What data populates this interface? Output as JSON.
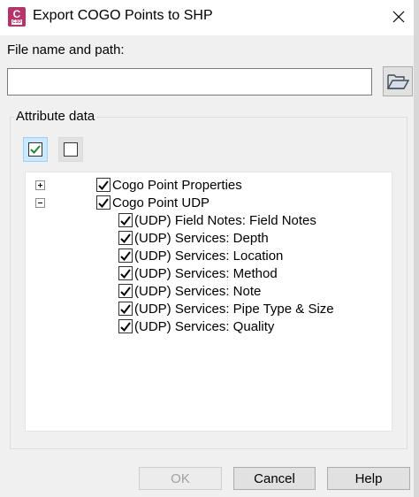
{
  "window": {
    "title": "Export COGO Points to SHP",
    "app_icon_letter": "C",
    "app_icon_sub": "C3D",
    "app_icon_color": "#b8336a"
  },
  "file": {
    "label": "File name and path:",
    "value": "",
    "placeholder": ""
  },
  "attributes": {
    "group_label": "Attribute data",
    "check_all_icon": "check-all-icon",
    "uncheck_all_icon": "uncheck-all-icon"
  },
  "tree": {
    "nodes": [
      {
        "label": "Cogo Point Properties",
        "checked": true,
        "expanded": false,
        "level": 0
      },
      {
        "label": "Cogo Point UDP",
        "checked": true,
        "expanded": true,
        "level": 0
      },
      {
        "label": "(UDP) Field Notes: Field Notes",
        "checked": true,
        "level": 1
      },
      {
        "label": "(UDP) Services: Depth",
        "checked": true,
        "level": 1
      },
      {
        "label": "(UDP) Services: Location",
        "checked": true,
        "level": 1
      },
      {
        "label": "(UDP) Services: Method",
        "checked": true,
        "level": 1
      },
      {
        "label": "(UDP) Services: Note",
        "checked": true,
        "level": 1
      },
      {
        "label": "(UDP) Services: Pipe Type & Size",
        "checked": true,
        "level": 1
      },
      {
        "label": "(UDP) Services: Quality",
        "checked": true,
        "level": 1
      }
    ]
  },
  "buttons": {
    "ok": "OK",
    "cancel": "Cancel",
    "help": "Help"
  }
}
